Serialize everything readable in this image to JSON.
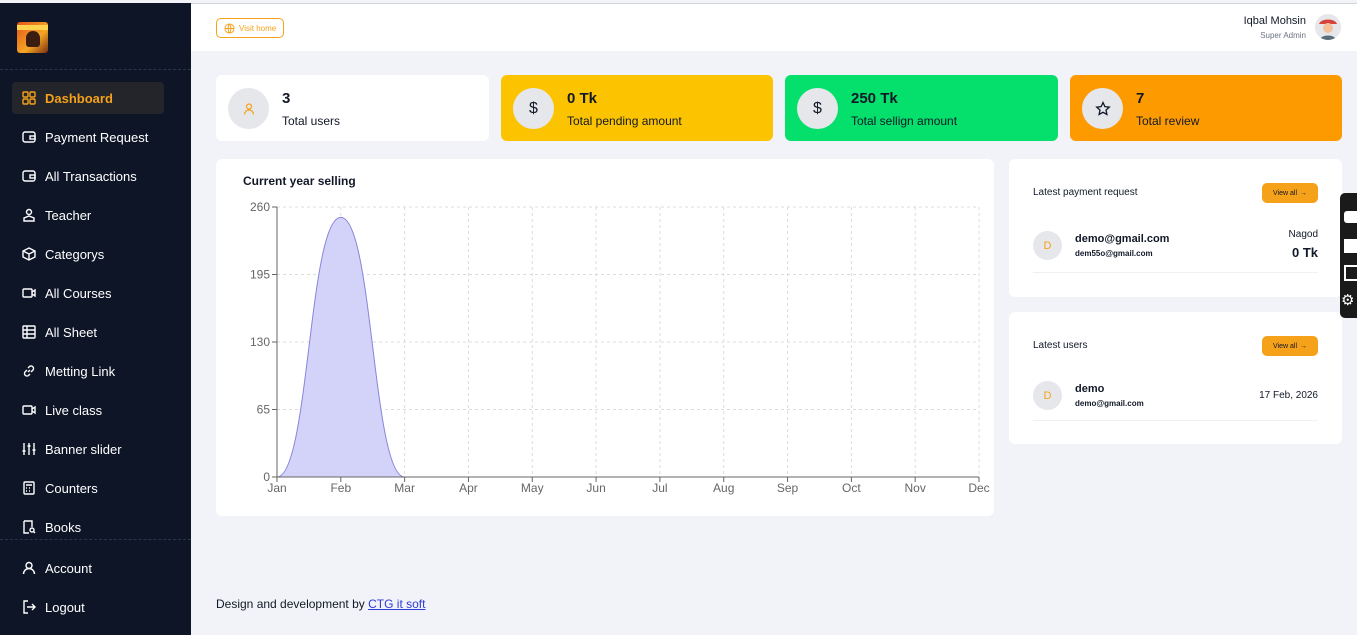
{
  "sidebar": {
    "items": [
      {
        "label": "Dashboard",
        "icon": "grid-icon"
      },
      {
        "label": "Payment Request",
        "icon": "wallet-icon"
      },
      {
        "label": "All Transactions",
        "icon": "wallet-icon"
      },
      {
        "label": "Teacher",
        "icon": "teacher-icon"
      },
      {
        "label": "Categorys",
        "icon": "box-icon"
      },
      {
        "label": "All Courses",
        "icon": "video-icon"
      },
      {
        "label": "All Sheet",
        "icon": "table-icon"
      },
      {
        "label": "Metting Link",
        "icon": "link-icon"
      },
      {
        "label": "Live class",
        "icon": "video-icon"
      },
      {
        "label": "Banner slider",
        "icon": "sliders-icon"
      },
      {
        "label": "Counters",
        "icon": "calculator-icon"
      },
      {
        "label": "Books",
        "icon": "book-search-icon"
      }
    ],
    "bottom": [
      {
        "label": "Account",
        "icon": "user-icon"
      },
      {
        "label": "Logout",
        "icon": "logout-icon"
      }
    ],
    "accent": "#f5a11a",
    "background": "#0d1527"
  },
  "topbar": {
    "visit_label": "Visit home",
    "user_name": "Iqbal Mohsin",
    "user_role": "Super Admin"
  },
  "stats": [
    {
      "value": "3",
      "label": "Total users",
      "icon": "user-icon",
      "color": "#ffffff"
    },
    {
      "value": "0 Tk",
      "label": "Total pending amount",
      "icon": "dollar-icon",
      "color": "#fcc400"
    },
    {
      "value": "250 Tk",
      "label": "Total sellign amount",
      "icon": "dollar-icon",
      "color": "#05df6c"
    },
    {
      "value": "7",
      "label": "Total review",
      "icon": "star-icon",
      "color": "#fd9a00"
    }
  ],
  "chart": {
    "title": "Current year selling"
  },
  "chart_data": {
    "type": "area",
    "title": "Current year selling",
    "categories": [
      "Jan",
      "Feb",
      "Mar",
      "Apr",
      "May",
      "Jun",
      "Jul",
      "Aug",
      "Sep",
      "Oct",
      "Nov",
      "Dec"
    ],
    "values": [
      0,
      250,
      0,
      0,
      0,
      0,
      0,
      0,
      0,
      0,
      0,
      0
    ],
    "yticks": [
      0,
      65,
      130,
      195,
      260
    ],
    "ylim": [
      0,
      260
    ],
    "grid": true,
    "fill_color": "#d3d3fa",
    "line_color": "#8884d8"
  },
  "payment_card": {
    "title": "Latest payment request",
    "view_all": "View all",
    "rows": [
      {
        "initial": "D",
        "email": "demo@gmail.com",
        "sub": "dem55o@gmail.com",
        "method": "Nagod",
        "amount": "0 Tk"
      }
    ]
  },
  "users_card": {
    "title": "Latest users",
    "view_all": "View all",
    "rows": [
      {
        "initial": "D",
        "name": "demo",
        "email": "demo@gmail.com",
        "date": "17 Feb, 2026"
      }
    ]
  },
  "footer": {
    "text": "Design and development by ",
    "link": "CTG it soft"
  }
}
